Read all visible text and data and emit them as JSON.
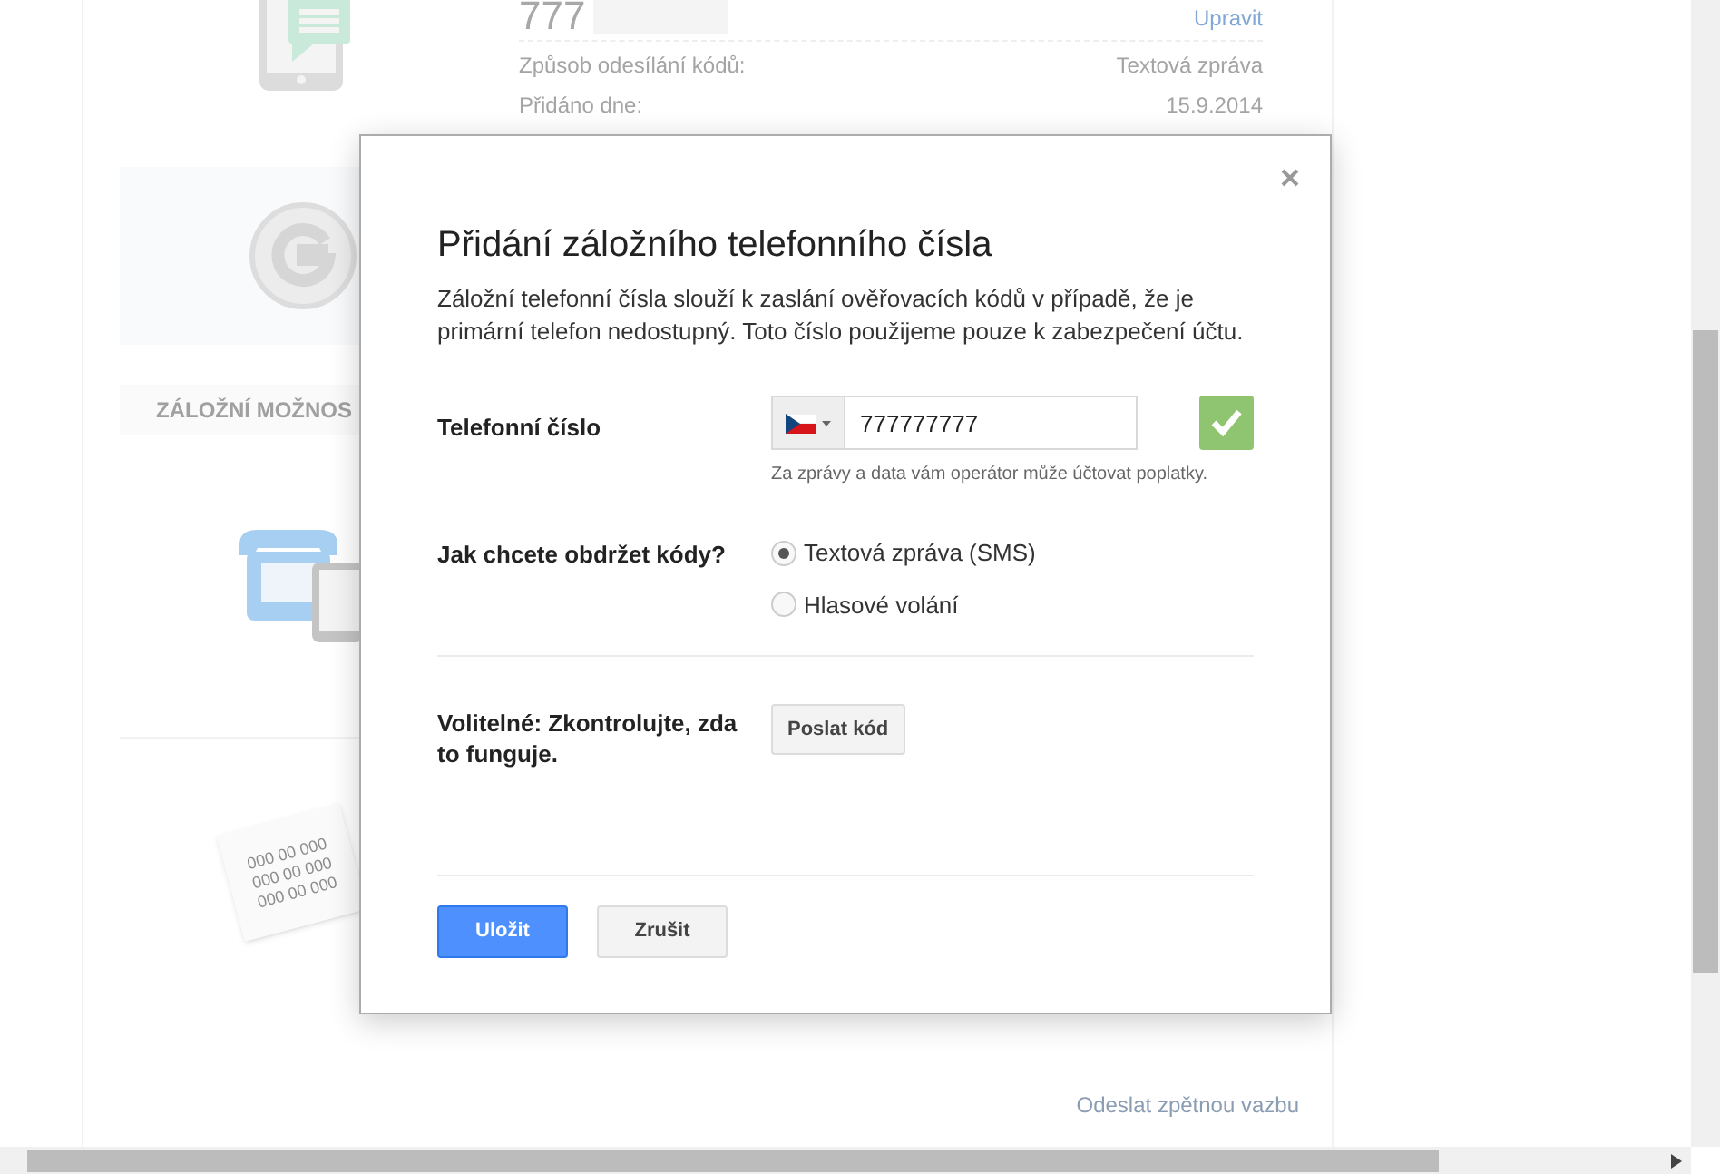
{
  "background": {
    "phone_number": "777",
    "edit_link": "Upravit",
    "details": [
      {
        "label": "Způsob odesílání kódů:",
        "value": "Textová zpráva"
      },
      {
        "label": "Přidáno dne:",
        "value": "15.9.2014"
      }
    ],
    "section_heading": "ZÁLOŽNÍ MOŽNOS",
    "backup_codes": [
      "000 00 000",
      "000 00 000",
      "000 00 000"
    ],
    "feedback_link": "Odeslat zpětnou vazbu"
  },
  "dialog": {
    "title": "Přidání záložního telefonního čísla",
    "description": "Záložní telefonní čísla slouží k zaslání ověřovacích kódů v případě, že je primární telefon nedostupný. Toto číslo použijeme pouze k zabezpečení účtu.",
    "phone": {
      "label": "Telefonní číslo",
      "value": "777777777",
      "hint": "Za zprávy a data vám operátor může účtovat poplatky.",
      "valid": true
    },
    "method": {
      "label": "Jak chcete obdržet kódy?",
      "options": [
        {
          "label": "Textová zpráva (SMS)",
          "selected": true
        },
        {
          "label": "Hlasové volání",
          "selected": false
        }
      ]
    },
    "test": {
      "label": "Volitelné: Zkontrolujte, zda to funguje.",
      "button": "Poslat kód"
    },
    "buttons": [
      {
        "label": "Uložit",
        "kind": "primary"
      },
      {
        "label": "Zrušit",
        "kind": "secondary"
      }
    ]
  }
}
